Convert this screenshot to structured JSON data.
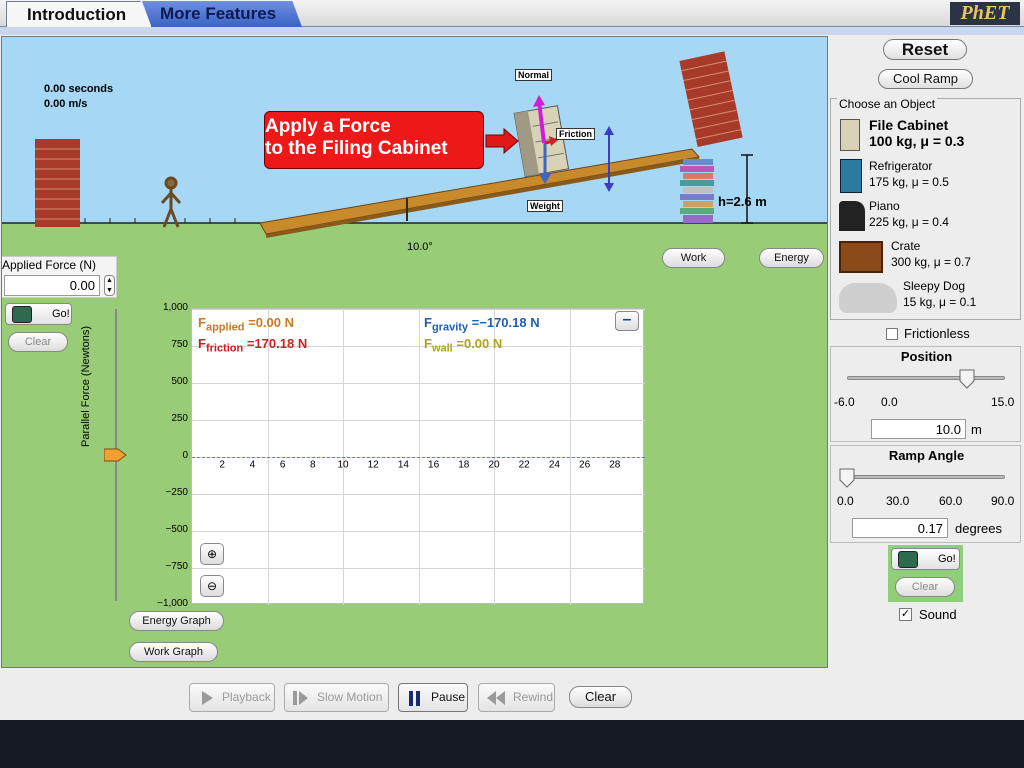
{
  "tabs": {
    "introduction": "Introduction",
    "more_features": "More Features"
  },
  "logo": "PhET",
  "readouts": {
    "time": "0.00 seconds",
    "speed": "0.00 m/s"
  },
  "callout": {
    "line1": "Apply a Force",
    "line2": "to the Filing Cabinet"
  },
  "force_labels": {
    "normal": "Normal",
    "friction": "Friction",
    "weight": "Weight"
  },
  "height_label": "h=2.6 m",
  "angle_label": "10.0°",
  "applied_force": {
    "title": "Applied Force (N)",
    "value": "0.00"
  },
  "go_label": "Go!",
  "clear_label": "Clear",
  "scene_buttons": {
    "work": "Work",
    "energy": "Energy"
  },
  "graph": {
    "ylabel": "Parallel Force (Newtons)",
    "yticks": [
      "1,000",
      "750",
      "500",
      "250",
      "0",
      "−250",
      "−500",
      "−750",
      "−1,000"
    ],
    "xticks": [
      "2",
      "4",
      "6",
      "8",
      "10",
      "12",
      "14",
      "16",
      "18",
      "20",
      "22",
      "24",
      "26",
      "28"
    ],
    "legend": {
      "applied_sub": "applied",
      "applied_val": "0.00 N",
      "friction_sub": "friction",
      "friction_val": "170.18 N",
      "gravity_sub": "gravity",
      "gravity_val": "−170.18 N",
      "wall_sub": "wall",
      "wall_val": "0.00 N"
    },
    "minimize": "–"
  },
  "graph_buttons": {
    "energy": "Energy Graph",
    "work": "Work Graph"
  },
  "right": {
    "reset": "Reset",
    "cool_ramp": "Cool Ramp",
    "choose_title": "Choose an Object",
    "objects": [
      {
        "name": "File Cabinet",
        "spec": "100 kg, μ = 0.3"
      },
      {
        "name": "Refrigerator",
        "spec": "175 kg, μ = 0.5"
      },
      {
        "name": "Piano",
        "spec": "225 kg, μ = 0.4"
      },
      {
        "name": "Crate",
        "spec": "300 kg, μ = 0.7"
      },
      {
        "name": "Sleepy Dog",
        "spec": "15 kg, μ = 0.1"
      }
    ],
    "frictionless": "Frictionless",
    "position": {
      "title": "Position",
      "ticks": [
        "-6.0",
        "0.0",
        "15.0"
      ],
      "value": "10.0",
      "unit": "m",
      "level": 10.0,
      "min": -6,
      "max": 15
    },
    "ramp_angle": {
      "title": "Ramp Angle",
      "ticks": [
        "0.0",
        "30.0",
        "60.0",
        "90.0"
      ],
      "value": "0.17",
      "unit": "degrees",
      "level": 0.17,
      "min": 0,
      "max": 90
    },
    "sound": "Sound"
  },
  "bottom": {
    "playback": "Playback",
    "slow_motion": "Slow Motion",
    "pause": "Pause",
    "rewind": "Rewind",
    "clear": "Clear"
  },
  "colors": {
    "applied": "#c87a1e",
    "friction": "#cc1f1f",
    "gravity": "#1f5fb0",
    "wall": "#b0a21a",
    "sky": "#a6d7f5",
    "grass": "#99cc77"
  }
}
